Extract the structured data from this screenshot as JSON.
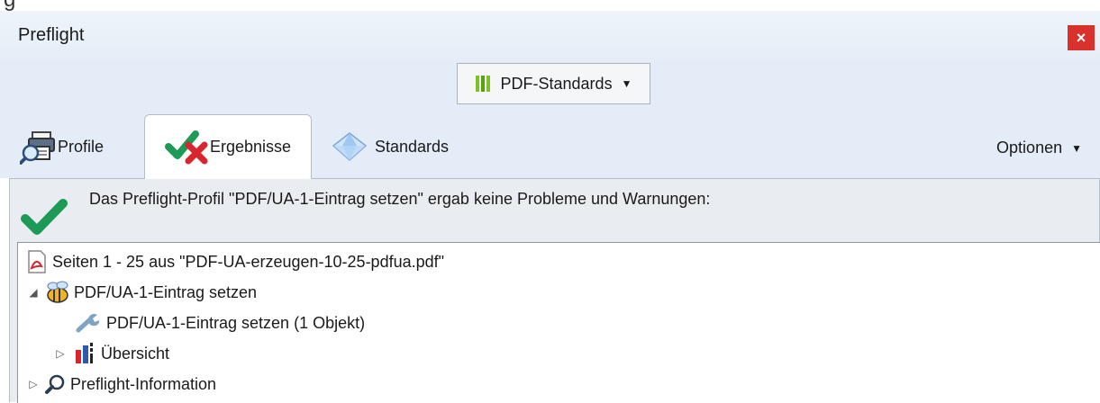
{
  "window": {
    "title": "Preflight",
    "close_label": "×"
  },
  "toolbar": {
    "dropdown_label": "PDF-Standards"
  },
  "tabs": [
    {
      "label": "Profile"
    },
    {
      "label": "Ergebnisse",
      "active": true
    },
    {
      "label": "Standards"
    }
  ],
  "options": {
    "label": "Optionen"
  },
  "result": {
    "message": "Das Preflight-Profil \"PDF/UA-1-Eintrag setzen\" ergab keine Probleme und Warnungen:"
  },
  "tree": {
    "items": [
      {
        "label": "Seiten 1 - 25 aus \"PDF-UA-erzeugen-10-25-pdfua.pdf\"",
        "icon": "pdf-file-icon"
      },
      {
        "label": "PDF/UA-1-Eintrag setzen",
        "icon": "profile-bee-icon",
        "expanded": true
      },
      {
        "label": "PDF/UA-1-Eintrag setzen (1 Objekt)",
        "icon": "wrench-icon"
      },
      {
        "label": "Übersicht",
        "icon": "bar-chart-icon",
        "expanded": false
      },
      {
        "label": "Preflight-Information",
        "icon": "magnifier-icon",
        "expanded": false
      }
    ]
  },
  "colors": {
    "titlebar": "#e4edf7",
    "close": "#d9312c",
    "check_green": "#1e9a57",
    "cross_red": "#d8262e"
  }
}
